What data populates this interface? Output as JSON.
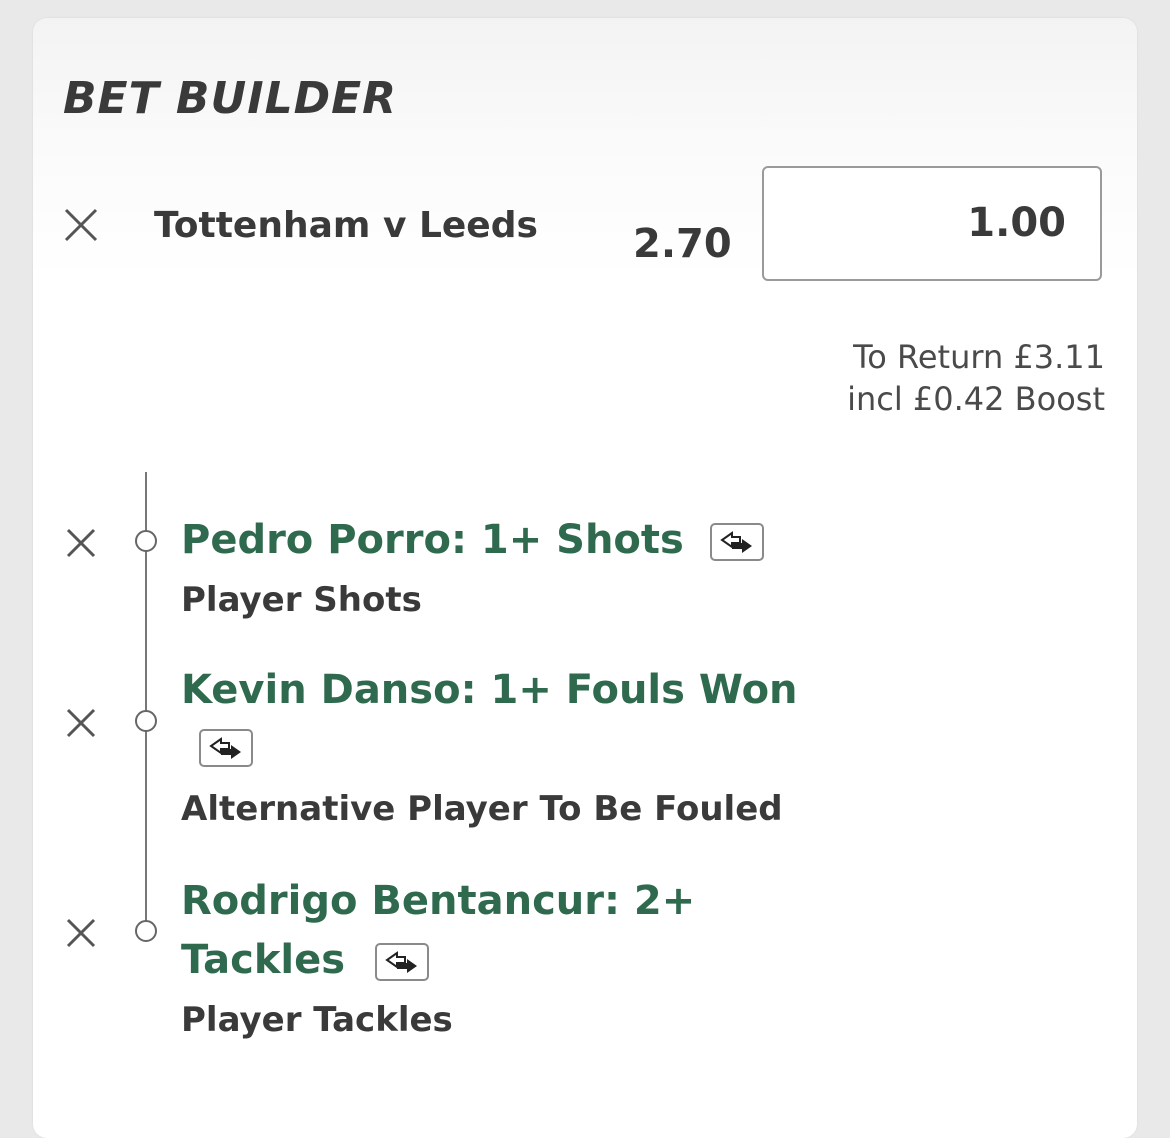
{
  "header": {
    "title": "BET BUILDER"
  },
  "bet": {
    "match": "Tottenham v Leeds",
    "odds": "2.70",
    "stake_value": "1.00",
    "to_return": "To Return £3.11",
    "boost": "incl £0.42 Boost"
  },
  "legs": [
    {
      "title": "Pedro Porro: 1+ Shots",
      "market": "Player Shots"
    },
    {
      "title": "Kevin Danso: 1+ Fouls Won",
      "market": "Alternative Player To Be Fouled"
    },
    {
      "title_line1": "Rodrigo Bentancur: 2+",
      "title_line2": "Tackles",
      "market": "Player Tackles"
    }
  ],
  "icons": {
    "remove": "close-icon",
    "swap": "swap-icon"
  },
  "colors": {
    "selection_green": "#2f6a4f",
    "text_dark": "#3a3a3a",
    "background": "#e9e9e9"
  }
}
